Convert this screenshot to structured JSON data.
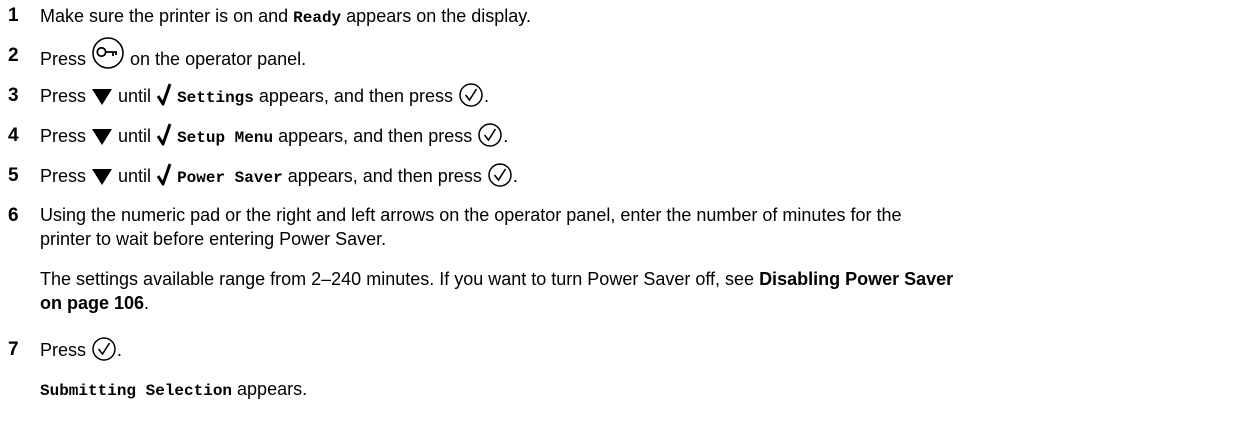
{
  "steps": [
    {
      "number": "1",
      "text_a": "Make sure the printer is on and ",
      "code": "Ready",
      "text_b": " appears on the display."
    },
    {
      "number": "2",
      "text_a": "Press ",
      "icon": "menu-key-icon",
      "text_b": " on the operator panel."
    },
    {
      "number": "3",
      "text_a": "Press ",
      "icon_a": "down-arrow-icon",
      "text_b": " until ",
      "icon_b": "checkmark-icon",
      "code": "Settings",
      "text_c": " appears, and then press ",
      "icon_c": "select-button-icon",
      "text_d": "."
    },
    {
      "number": "4",
      "text_a": "Press ",
      "icon_a": "down-arrow-icon",
      "text_b": " until ",
      "icon_b": "checkmark-icon",
      "code": "Setup Menu",
      "text_c": " appears, and then press ",
      "icon_c": "select-button-icon",
      "text_d": "."
    },
    {
      "number": "5",
      "text_a": "Press ",
      "icon_a": "down-arrow-icon",
      "text_b": " until ",
      "icon_b": "checkmark-icon",
      "code": "Power Saver",
      "text_c": " appears, and then press ",
      "icon_c": "select-button-icon",
      "text_d": "."
    },
    {
      "number": "6",
      "line_1": "Using the numeric pad or the right and left arrows on the operator panel, enter the number of minutes for the",
      "line_2": "printer to wait before entering Power Saver.",
      "note_a": "The settings available range from 2–240 minutes. If you want to turn Power Saver off, see ",
      "note_link_1": "Disabling Power Saver",
      "note_link_2": "on page 106",
      "note_b": "."
    },
    {
      "number": "7",
      "text_a": "Press ",
      "icon": "select-button-icon",
      "text_b": ".",
      "result_code": "Submitting Selection",
      "result_text": " appears."
    }
  ]
}
